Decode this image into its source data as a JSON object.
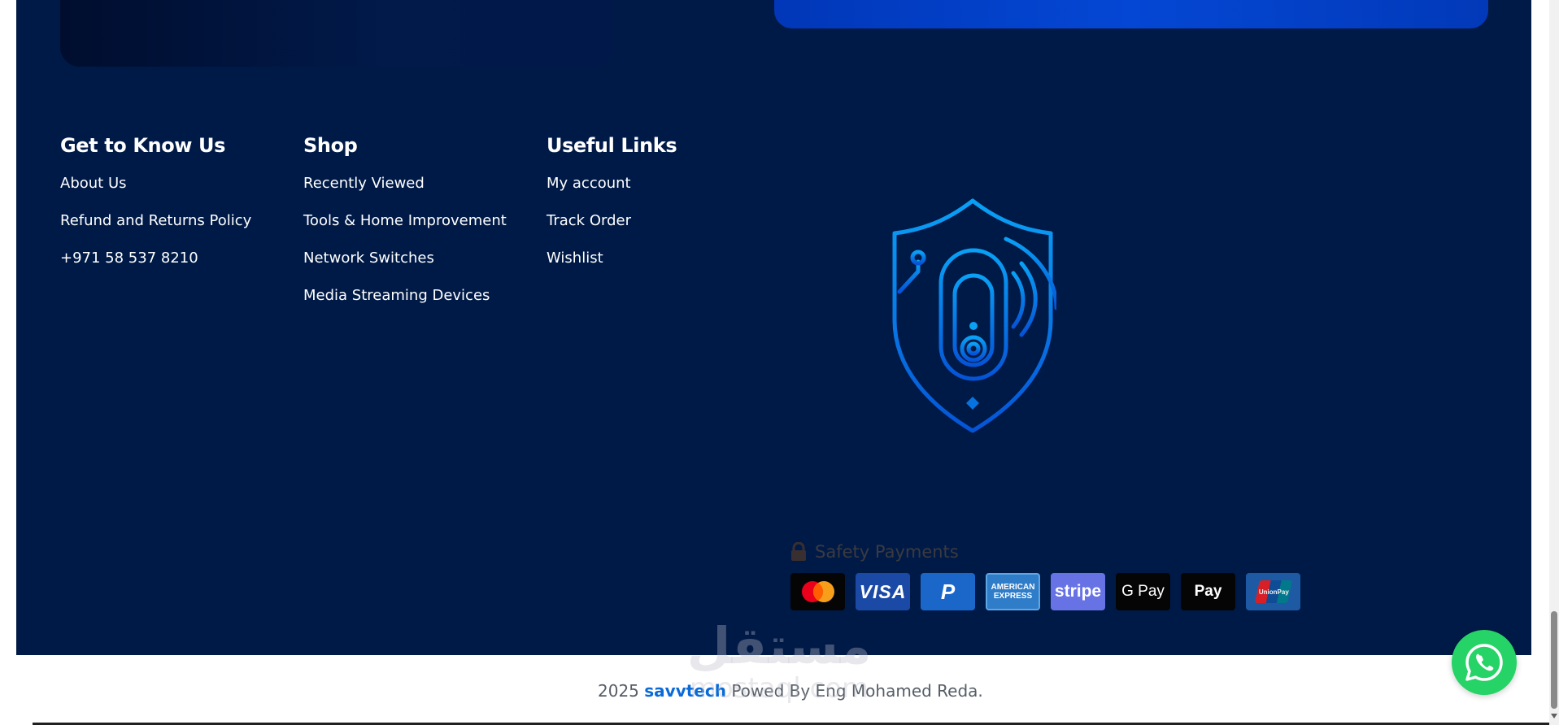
{
  "footer": {
    "columns": [
      {
        "title": "Get to Know Us",
        "links": [
          "About Us",
          "Refund and Returns Policy",
          "+971 58 537 8210"
        ]
      },
      {
        "title": "Shop",
        "links": [
          "Recently Viewed",
          "Tools & Home Improvement",
          "Network Switches",
          "Media Streaming Devices"
        ]
      },
      {
        "title": "Useful Links",
        "links": [
          "My account",
          "Track Order",
          "Wishlist"
        ]
      }
    ],
    "safety_label": "Safety Payments",
    "payment_methods": [
      {
        "label": "",
        "icon": "mastercard-icon"
      },
      {
        "label": "VISA",
        "icon": "visa-icon"
      },
      {
        "label": "P",
        "icon": "paypal-icon"
      },
      {
        "label": "AMERICAN EXPRESS",
        "icon": "amex-icon"
      },
      {
        "label": "stripe",
        "icon": "stripe-icon"
      },
      {
        "label": "G Pay",
        "icon": "google-pay-icon"
      },
      {
        "label": " Pay",
        "icon": "apple-pay-icon"
      },
      {
        "label": "UnionPay",
        "icon": "unionpay-icon"
      }
    ]
  },
  "bottom": {
    "year": "2025",
    "brand": "savvtech",
    "powered_by": "Powed By Eng Mohamed Reda."
  },
  "watermark": {
    "arabic": "مستقل",
    "latin": "mostaql.com"
  },
  "colors": {
    "footer_bg": "#001a47",
    "accent_blue": "#0a6ad8",
    "shield_blue": "#0a8df0",
    "whatsapp": "#25d366"
  }
}
